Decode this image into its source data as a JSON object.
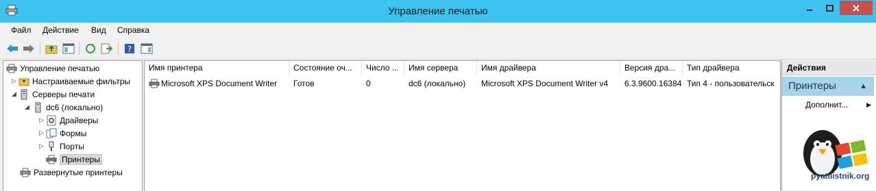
{
  "window": {
    "title": "Управление печатью"
  },
  "menu": [
    "Файл",
    "Действие",
    "Вид",
    "Справка"
  ],
  "tree": {
    "root": "Управление печатью",
    "custom_filters": "Настраиваемые фильтры",
    "print_servers": "Серверы печати",
    "server": "dc6 (локально)",
    "drivers": "Драйверы",
    "forms": "Формы",
    "ports": "Порты",
    "printers": "Принтеры",
    "deployed": "Развернутые принтеры"
  },
  "table": {
    "columns": [
      "Имя принтера",
      "Состояние оч...",
      "Число ...",
      "Имя сервера",
      "Имя драйвера",
      "Версия дра...",
      "Тип драйвера"
    ],
    "rows": [
      [
        "Microsoft XPS Document Writer",
        "Готов",
        "0",
        "dc6 (локально)",
        "Microsoft XPS Document Writer v4",
        "6.3.9600.16384",
        "Тип 4 - пользовательск"
      ]
    ]
  },
  "actions": {
    "header": "Действия",
    "section": "Принтеры",
    "more": "Дополнит..."
  },
  "watermark": "pyatilistnik.org",
  "colors": {
    "titlebar": "#3ec3f0",
    "close": "#c7504b",
    "section": "#a8d4ea"
  }
}
